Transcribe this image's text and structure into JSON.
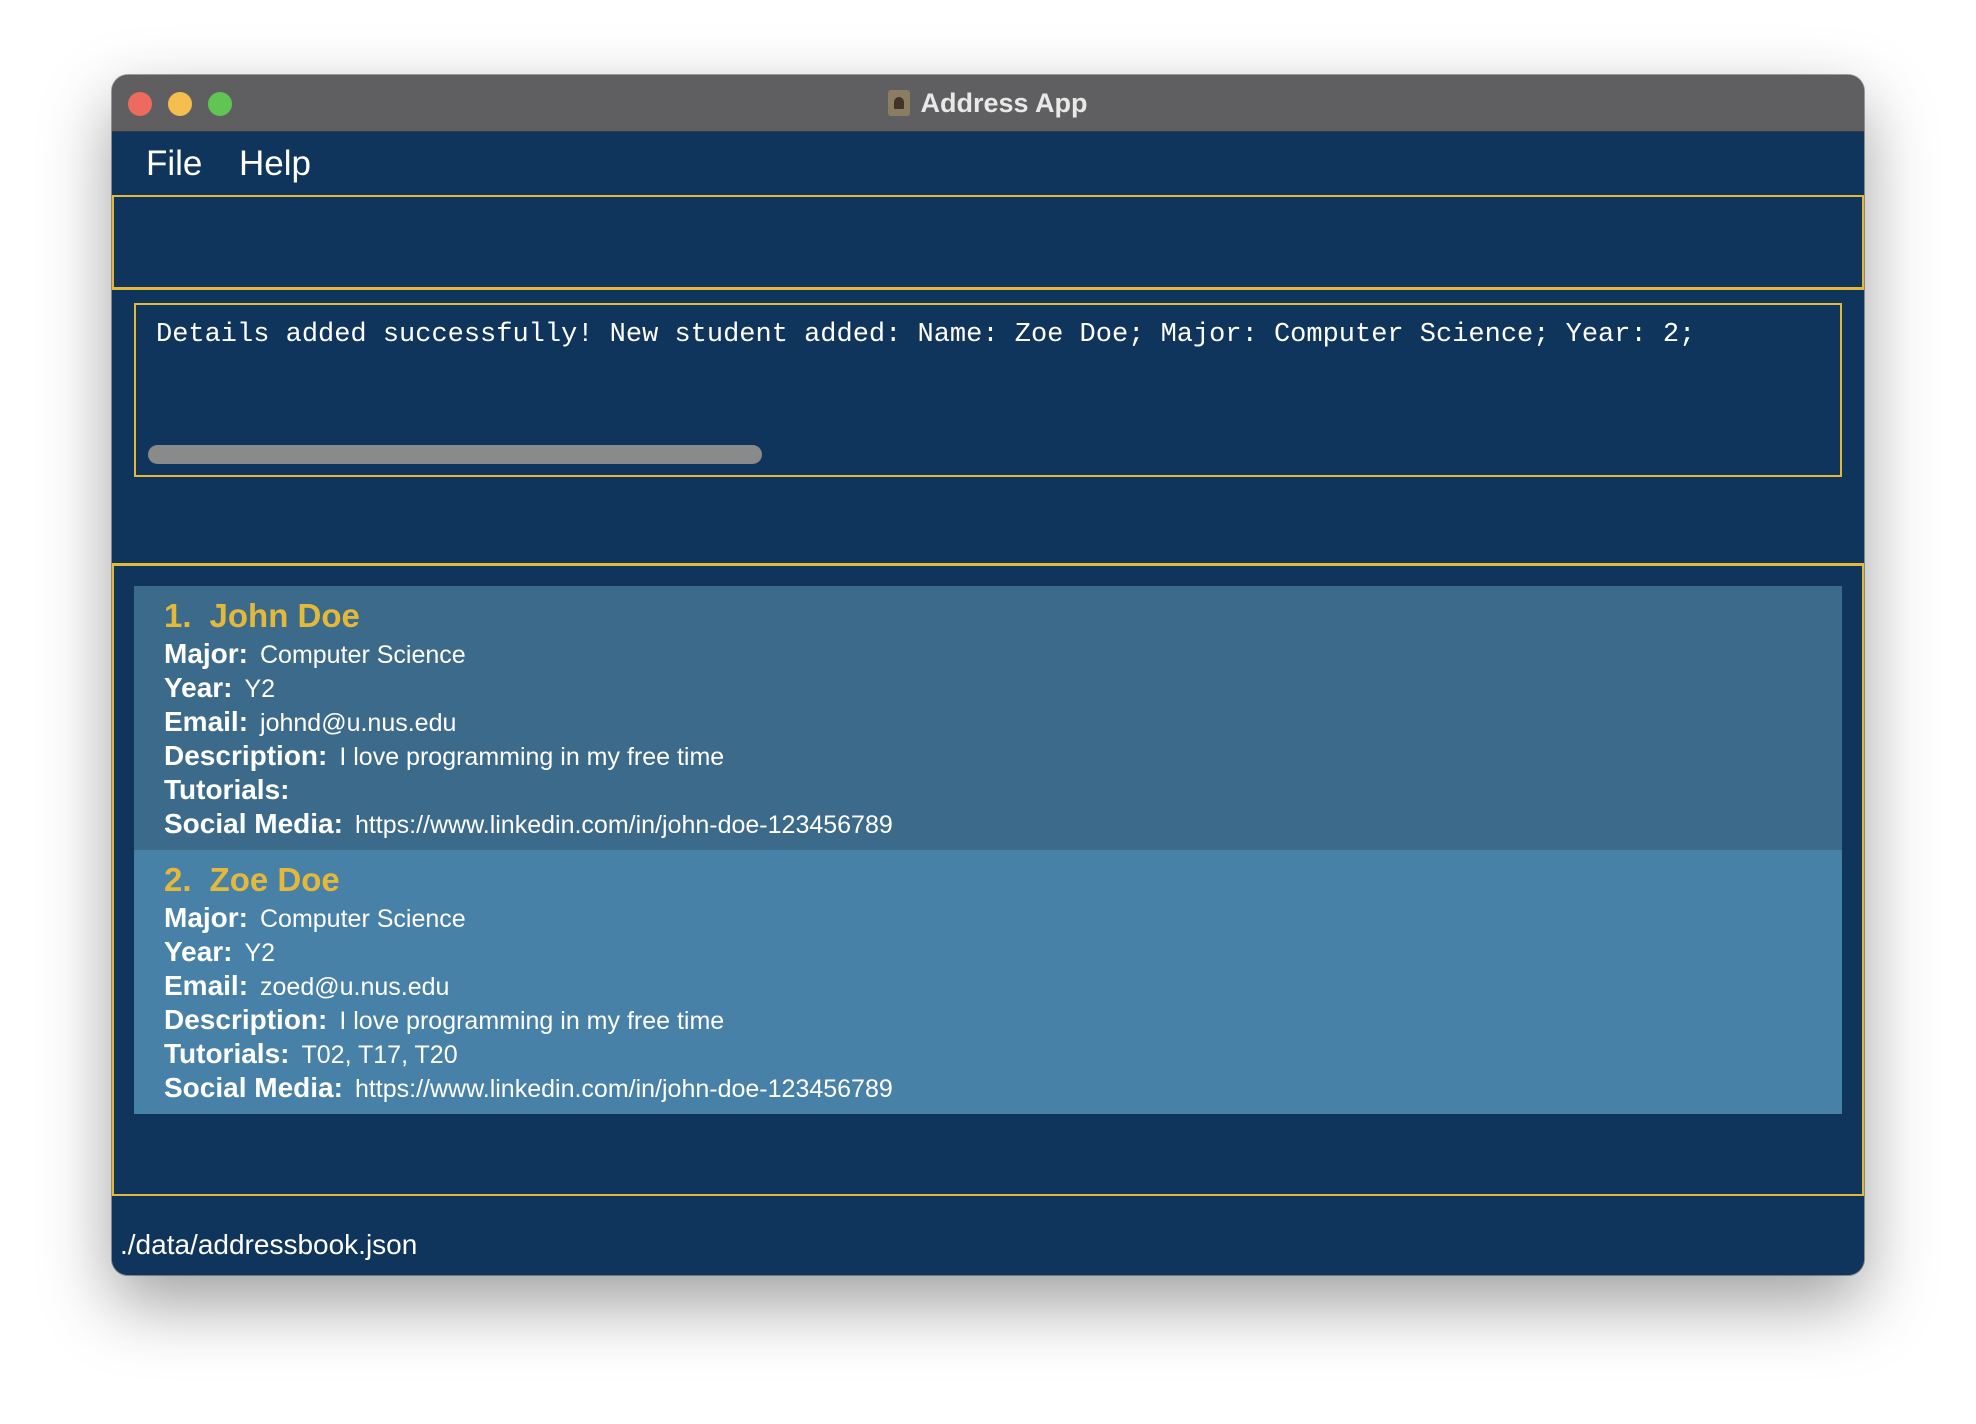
{
  "window": {
    "title": "Address App",
    "icon": "address-book-icon"
  },
  "menu": {
    "items": [
      {
        "label": "File"
      },
      {
        "label": "Help"
      }
    ]
  },
  "command_box": {
    "value": "",
    "placeholder": ""
  },
  "result": {
    "text": "Details added successfully! New student added: Name: Zoe Doe; Major: Computer Science; Year: 2;"
  },
  "persons": [
    {
      "index": "1.",
      "name": "John Doe",
      "fields": [
        {
          "label": "Major:",
          "value": "Computer Science"
        },
        {
          "label": "Year:",
          "value": "Y2"
        },
        {
          "label": "Email:",
          "value": "johnd@u.nus.edu"
        },
        {
          "label": "Description:",
          "value": "I love programming in my free time"
        },
        {
          "label": "Tutorials:",
          "value": ""
        },
        {
          "label": "Social Media:",
          "value": "https://www.linkedin.com/in/john-doe-123456789"
        }
      ]
    },
    {
      "index": "2.",
      "name": "Zoe Doe",
      "fields": [
        {
          "label": "Major:",
          "value": "Computer Science"
        },
        {
          "label": "Year:",
          "value": "Y2"
        },
        {
          "label": "Email:",
          "value": "zoed@u.nus.edu"
        },
        {
          "label": "Description:",
          "value": "I love programming in my free time"
        },
        {
          "label": "Tutorials:",
          "value": "T02, T17, T20"
        },
        {
          "label": "Social Media:",
          "value": "https://www.linkedin.com/in/john-doe-123456789"
        }
      ]
    }
  ],
  "status": {
    "path": "./data/addressbook.json"
  },
  "colors": {
    "background": "#10355c",
    "accent": "#e4b93a",
    "card_odd": "#3c6a8b",
    "card_even": "#4881a8",
    "titlebar": "#5f5f61"
  }
}
